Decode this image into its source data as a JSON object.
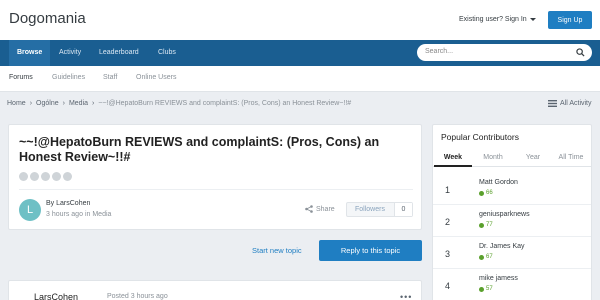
{
  "header": {
    "logo": "Dogomania",
    "existing_user": "Existing user? Sign In",
    "signup": "Sign Up"
  },
  "nav": {
    "items": [
      "Browse",
      "Activity",
      "Leaderboard",
      "Clubs"
    ],
    "search_placeholder": "Search..."
  },
  "subnav": {
    "items": [
      "Forums",
      "Guidelines",
      "Staff",
      "Online Users"
    ]
  },
  "breadcrumb": {
    "items": [
      "Home",
      "Ogólne",
      "Media"
    ],
    "current": "~~!@HepatoBurn REVIEWS and complaintS: (Pros, Cons) an Honest Review~!!#",
    "all_activity": "All Activity"
  },
  "topic": {
    "title": "~~!@HepatoBurn REVIEWS and complaintS: (Pros, Cons) an Honest Review~!!#",
    "rating": 0,
    "author_initial": "L",
    "by_prefix": "By",
    "author": "LarsCohen",
    "time": "3 hours ago",
    "in_text": "in",
    "forum": "Media",
    "share": "Share",
    "followers_label": "Followers",
    "followers_count": "0"
  },
  "actions": {
    "start_new_topic": "Start new topic",
    "reply": "Reply to this topic"
  },
  "post": {
    "author": "LarsCohen",
    "posted": "Posted 3 hours ago",
    "menu": "•••"
  },
  "sidebar": {
    "title": "Popular Contributors",
    "tabs": [
      "Week",
      "Month",
      "Year",
      "All Time"
    ],
    "contributors": [
      {
        "rank": "1",
        "name": "Matt Gordon",
        "rep": "66"
      },
      {
        "rank": "2",
        "name": "geniusparknews",
        "rep": "77"
      },
      {
        "rank": "3",
        "name": "Dr. James Kay",
        "rep": "67"
      },
      {
        "rank": "4",
        "name": "mike jamess",
        "rep": "57"
      }
    ]
  },
  "colors": {
    "brand": "#1a5e91",
    "accent": "#1f7ec2",
    "positive": "#5aa02c"
  }
}
